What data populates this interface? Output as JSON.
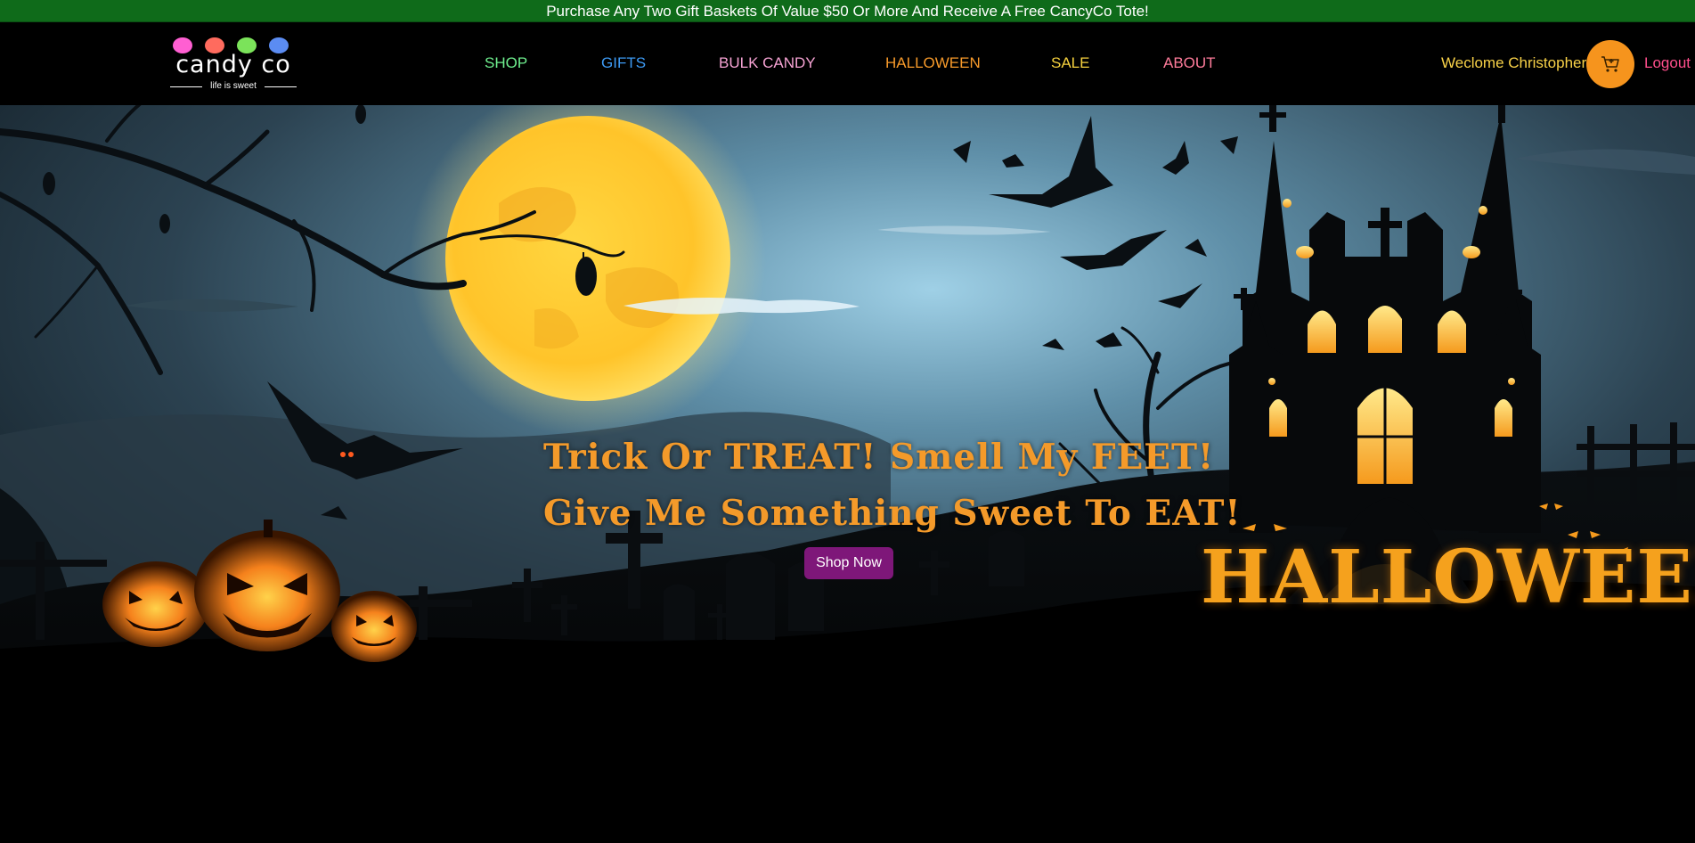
{
  "promo": {
    "text": "Purchase Any Two Gift Baskets Of Value $50 Or More And Receive A Free CancyCo Tote!"
  },
  "logo": {
    "name": "candy co",
    "tagline": "life is sweet",
    "dot_colors": [
      "#ff5fd2",
      "#ff6b5e",
      "#7be35a",
      "#5b8cf2"
    ]
  },
  "nav": {
    "items": [
      {
        "label": "SHOP",
        "color": "#6ff08f"
      },
      {
        "label": "GIFTS",
        "color": "#3d9bf5"
      },
      {
        "label": "BULK CANDY",
        "color": "#f7a3d4"
      },
      {
        "label": "HALLOWEEN",
        "color": "#f79a2a"
      },
      {
        "label": "SALE",
        "color": "#f7d23e"
      },
      {
        "label": "ABOUT",
        "color": "#ff7c9b"
      }
    ]
  },
  "user": {
    "greeting": "Weclome Christopher",
    "cart_icon": "cart-icon",
    "logout_label": "Logout"
  },
  "hero": {
    "headline_line1": "Trick Or TREAT!  Smell My FEET!",
    "headline_line2": "Give Me Something Sweet To EAT!",
    "cta_label": "Shop Now",
    "banner_title": "HALLOWEEN"
  }
}
